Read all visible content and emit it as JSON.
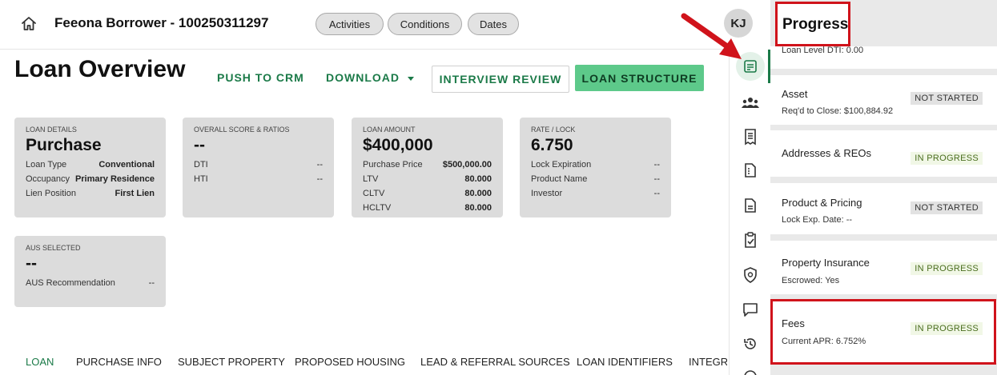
{
  "header": {
    "borrower": "Feeona Borrower - 100250311297",
    "pills": [
      "Activities",
      "Conditions",
      "Dates"
    ],
    "avatar_initials": "KJ"
  },
  "toolbar": {
    "page_title": "Loan Overview",
    "push_crm": "PUSH TO CRM",
    "download": "DOWNLOAD",
    "interview_review": "INTERVIEW REVIEW",
    "loan_structure": "LOAN STRUCTURE"
  },
  "cards": {
    "loan_details": {
      "label": "LOAN DETAILS",
      "value": "Purchase",
      "rows": [
        [
          "Loan Type",
          "Conventional"
        ],
        [
          "Occupancy",
          "Primary Residence"
        ],
        [
          "Lien Position",
          "First Lien"
        ]
      ]
    },
    "score": {
      "label": "OVERALL SCORE & RATIOS",
      "value": "--",
      "rows": [
        [
          "DTI",
          "--"
        ],
        [
          "HTI",
          "--"
        ]
      ]
    },
    "amount": {
      "label": "LOAN AMOUNT",
      "value": "$400,000",
      "rows": [
        [
          "Purchase Price",
          "$500,000.00"
        ],
        [
          "LTV",
          "80.000"
        ],
        [
          "CLTV",
          "80.000"
        ],
        [
          "HCLTV",
          "80.000"
        ]
      ]
    },
    "rate": {
      "label": "RATE / LOCK",
      "value": "6.750",
      "rows": [
        [
          "Lock Expiration",
          "--"
        ],
        [
          "Product Name",
          "--"
        ],
        [
          "Investor",
          "--"
        ]
      ]
    },
    "aus": {
      "label": "AUS SELECTED",
      "value": "--",
      "rows": [
        [
          "AUS Recommendation",
          "--"
        ]
      ]
    }
  },
  "tabs": [
    "LOAN",
    "PURCHASE INFO",
    "SUBJECT PROPERTY",
    "PROPOSED HOUSING",
    "LEAD & REFERRAL SOURCES",
    "LOAN IDENTIFIERS",
    "INTEGR"
  ],
  "rail_icons": [
    "summary-icon",
    "people-icon",
    "receipt-icon",
    "document-list-icon",
    "document-icon",
    "clipboard-check-icon",
    "shield-icon",
    "chat-icon",
    "history-icon",
    "clock-icon"
  ],
  "progress": {
    "title": "Progress",
    "partial_text": "Loan Level DTI: 0.00",
    "items": [
      {
        "title": "Asset",
        "sub": "Req'd to Close: $100,884.92",
        "status": "NOT STARTED"
      },
      {
        "title": "Addresses & REOs",
        "sub": "",
        "status": "IN PROGRESS"
      },
      {
        "title": "Product & Pricing",
        "sub": "Lock Exp. Date: --",
        "status": "NOT STARTED"
      },
      {
        "title": "Property Insurance",
        "sub": "Escrowed: Yes",
        "status": "IN PROGRESS"
      },
      {
        "title": "Fees",
        "sub": "Current APR: 6.752%",
        "status": "IN PROGRESS"
      }
    ]
  },
  "colors": {
    "accent": "#1b7a48",
    "primary_button": "#5dc98a",
    "annotation_red": "#d0131b",
    "card_bg": "#dcdcdc"
  }
}
